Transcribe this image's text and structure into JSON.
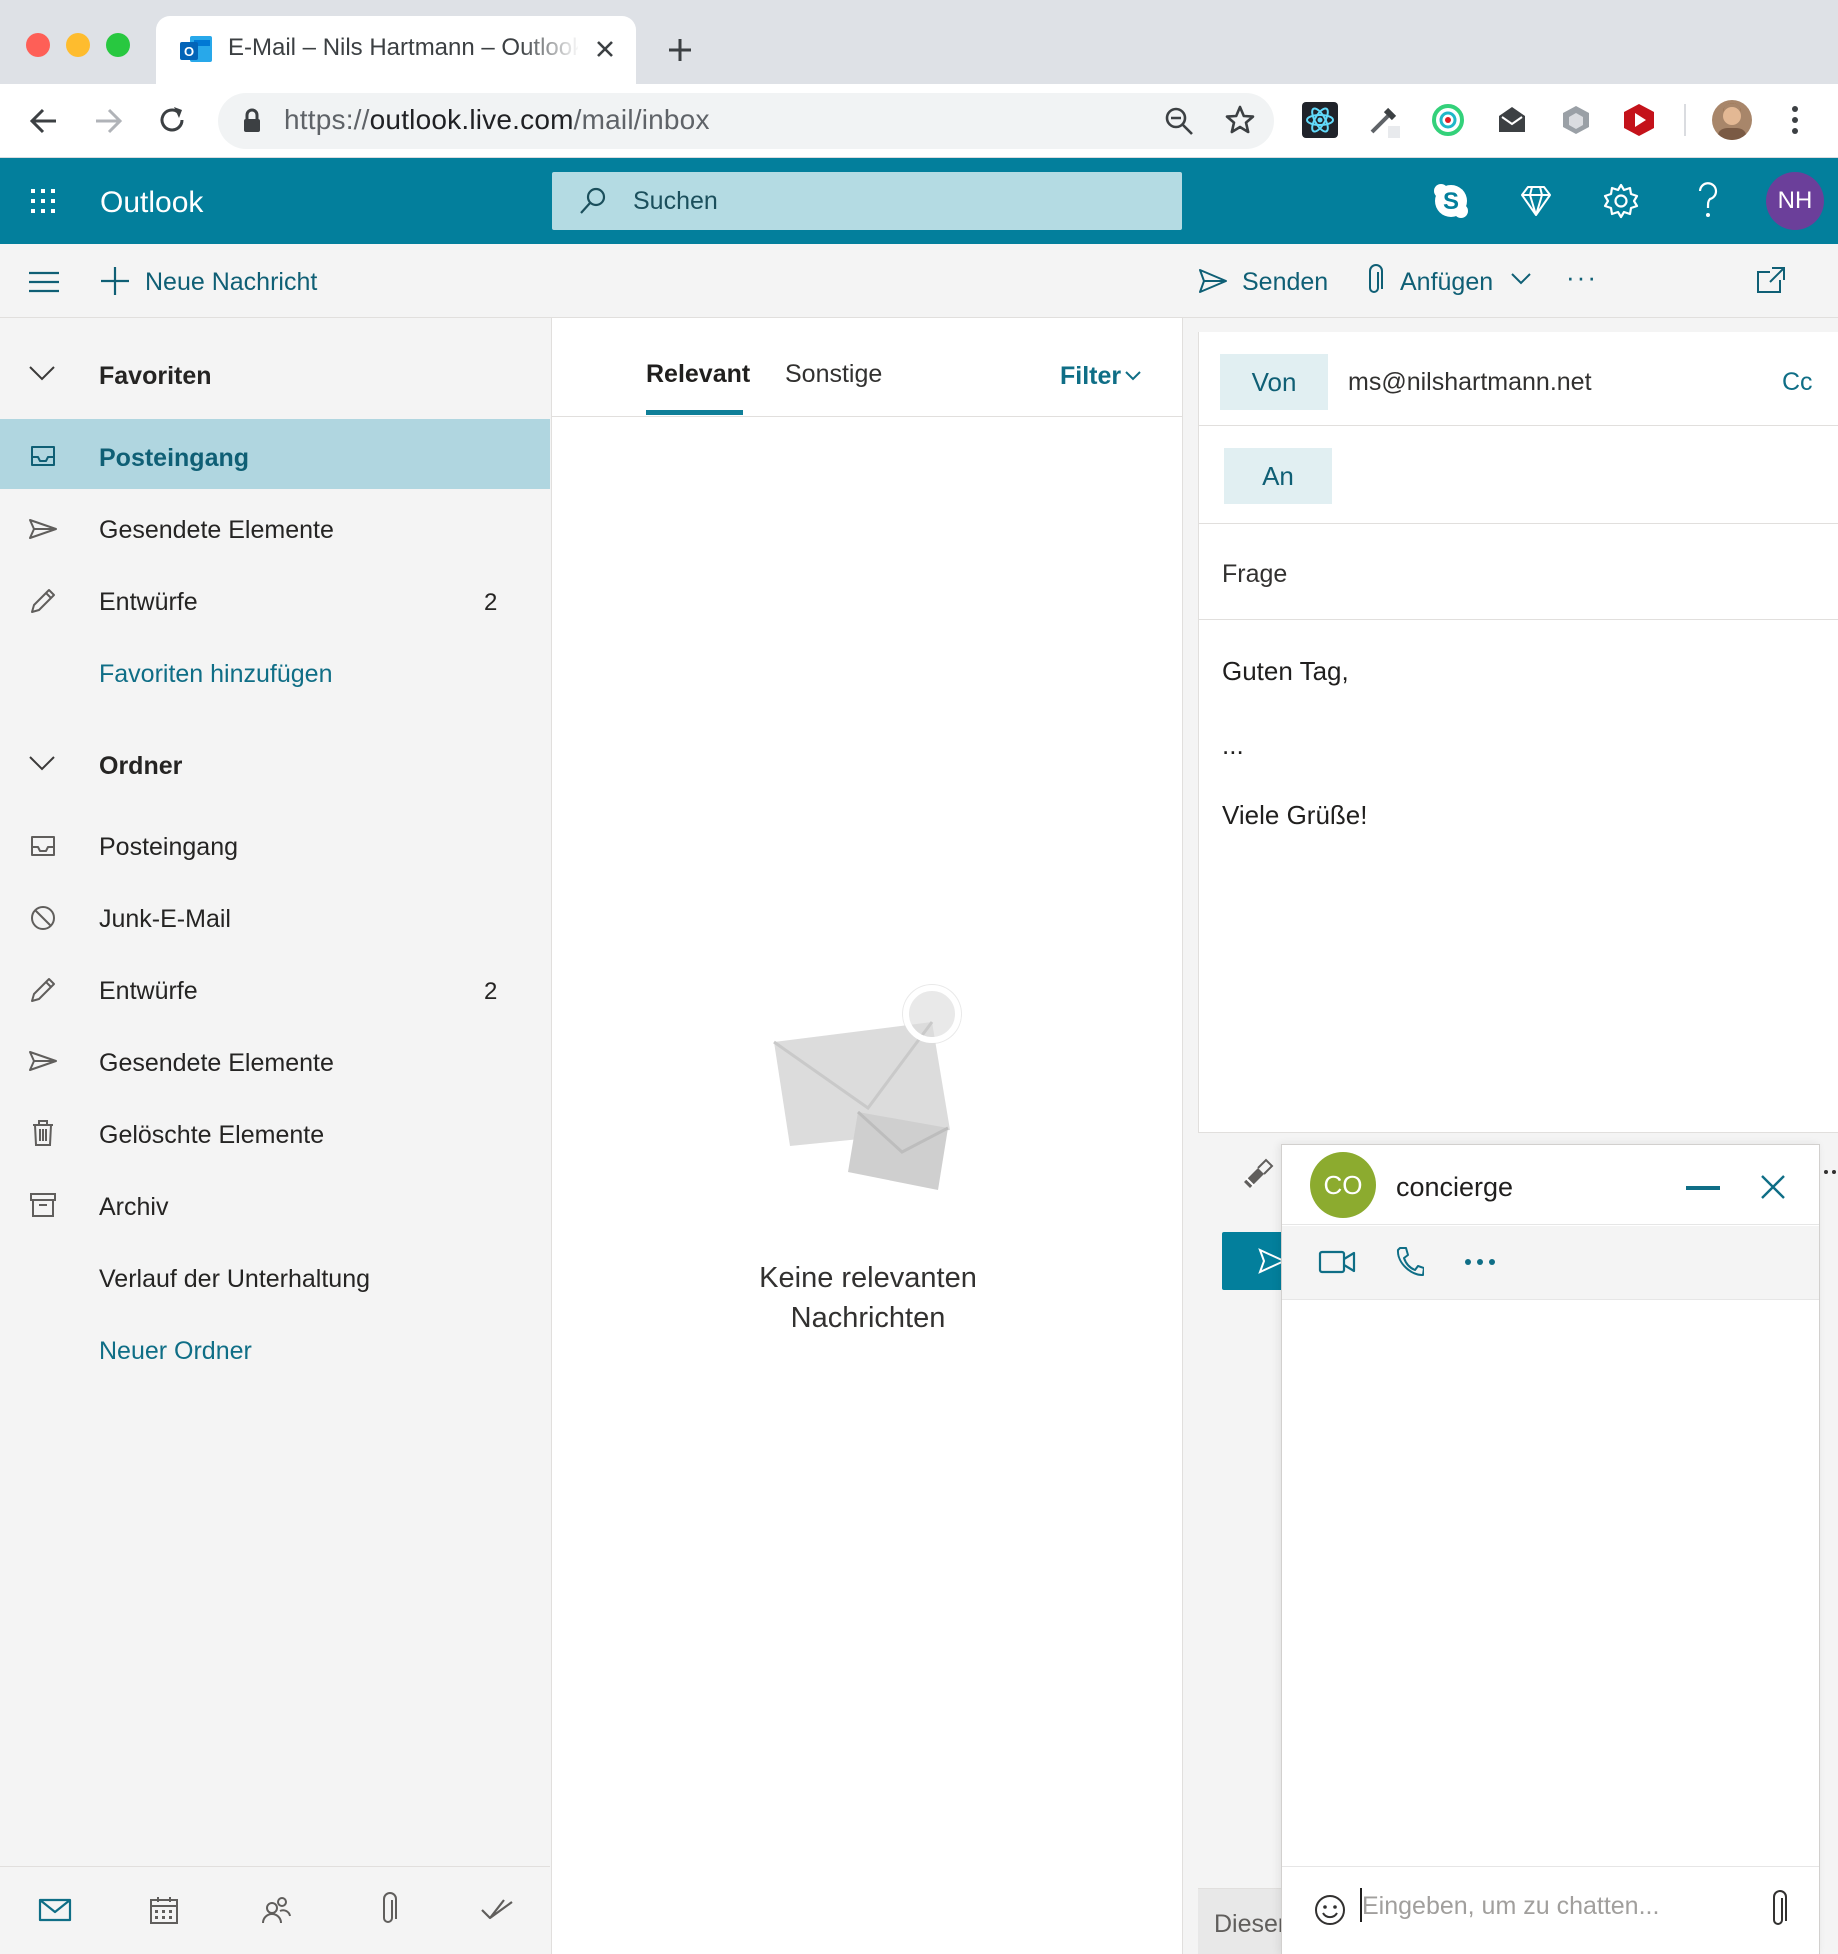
{
  "browser": {
    "tab_title": "E-Mail – Nils Hartmann – Outlook",
    "url_scheme": "https://",
    "url_host": "outlook.live.com",
    "url_path": "/mail/inbox",
    "icons": [
      "back-icon",
      "forward-icon",
      "reload-icon",
      "lock-icon",
      "zoom-icon",
      "star-icon",
      "react-devtools-icon",
      "eyedropper-icon",
      "extension-green-icon",
      "mail-extension-icon",
      "extension-grey-icon",
      "youtube-extension-icon",
      "profile-avatar",
      "more-menu-icon"
    ]
  },
  "header": {
    "brand": "Outlook",
    "search_placeholder": "Suchen",
    "user_initials": "NH",
    "accent_color": "#037f9c"
  },
  "commandbar": {
    "new_message": "Neue Nachricht",
    "send": "Senden",
    "attach": "Anfügen",
    "more": "···"
  },
  "nav": {
    "favorites_header": "Favoriten",
    "favorites": [
      {
        "label": "Posteingang",
        "count": "",
        "icon": "inbox-icon"
      },
      {
        "label": "Gesendete Elemente",
        "count": "",
        "icon": "send-icon"
      },
      {
        "label": "Entwürfe",
        "count": "2",
        "icon": "pencil-icon"
      }
    ],
    "add_favorite": "Favoriten hinzufügen",
    "folders_header": "Ordner",
    "folders": [
      {
        "label": "Posteingang",
        "count": "",
        "icon": "inbox-icon"
      },
      {
        "label": "Junk-E-Mail",
        "count": "",
        "icon": "block-icon"
      },
      {
        "label": "Entwürfe",
        "count": "2",
        "icon": "pencil-icon"
      },
      {
        "label": "Gesendete Elemente",
        "count": "",
        "icon": "send-icon"
      },
      {
        "label": "Gelöschte Elemente",
        "count": "",
        "icon": "trash-icon"
      },
      {
        "label": "Archiv",
        "count": "",
        "icon": "archive-icon"
      },
      {
        "label": "Verlauf der Unterhaltung",
        "count": "",
        "icon": ""
      }
    ],
    "new_folder": "Neuer Ordner"
  },
  "list": {
    "tab_relevant": "Relevant",
    "tab_other": "Sonstige",
    "filter": "Filter",
    "empty_line1": "Keine relevanten",
    "empty_line2": "Nachrichten"
  },
  "compose": {
    "from_label": "Von",
    "from_value": "ms@nilshartmann.net",
    "cc_label": "Cc",
    "to_label": "An",
    "subject": "Frage",
    "body_line1": "Guten Tag,",
    "body_line2": "...",
    "body_line3": "Viele Grüße!",
    "footer_partial": "Dieser"
  },
  "chat": {
    "initials": "CO",
    "name": "concierge",
    "input_placeholder": "Eingeben, um zu chatten..."
  }
}
